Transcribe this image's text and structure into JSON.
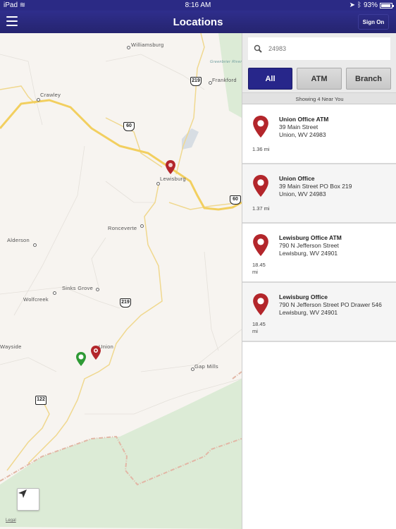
{
  "status_bar": {
    "device": "iPad",
    "time": "8:16 AM",
    "battery": "93%",
    "battery_level": 0.93
  },
  "nav": {
    "title": "Locations",
    "sign_on_label": "Sign On",
    "menu_icon": "hamburger-icon"
  },
  "search": {
    "value": "24983",
    "icon": "search-icon"
  },
  "filters": [
    {
      "label": "All",
      "active": true
    },
    {
      "label": "ATM",
      "active": false
    },
    {
      "label": "Branch",
      "active": false
    }
  ],
  "showing_text": "Showing 4 Near You",
  "locations": [
    {
      "name": "Union Office ATM",
      "address1": "39 Main Street",
      "address2": "Union, WV 24983",
      "distance": "1.36 mi"
    },
    {
      "name": "Union Office",
      "address1": "39 Main Street PO Box 219",
      "address2": "Union, WV 24983",
      "distance": "1.37 mi"
    },
    {
      "name": "Lewisburg Office ATM",
      "address1": "790 N Jefferson Street",
      "address2": "Lewisburg, WV 24901",
      "distance": "18.45 mi"
    },
    {
      "name": "Lewisburg Office",
      "address1": "790 N Jefferson Street PO Drawer 546",
      "address2": "Lewisburg, WV 24901",
      "distance": "18.45 mi"
    }
  ],
  "map": {
    "towns": [
      "Williamsburg",
      "Frankford",
      "Crawley",
      "Lewisburg",
      "Ronceverte",
      "Alderson",
      "Sinks Grove",
      "Wolfcreek",
      "Wayside",
      "Union",
      "Gap Mills"
    ],
    "river_label": "Greenbrier River",
    "route_shields": [
      "219",
      "60",
      "60",
      "219",
      "122"
    ],
    "legal_label": "Legal",
    "colors": {
      "pin_red": "#b3262b",
      "pin_green": "#2e9a35",
      "highway": "#f2cf5f",
      "forest": "#dcebd6",
      "land": "#f7f4f0"
    }
  },
  "colors": {
    "brand": "#2b2a85",
    "active_filter": "#27268a"
  }
}
